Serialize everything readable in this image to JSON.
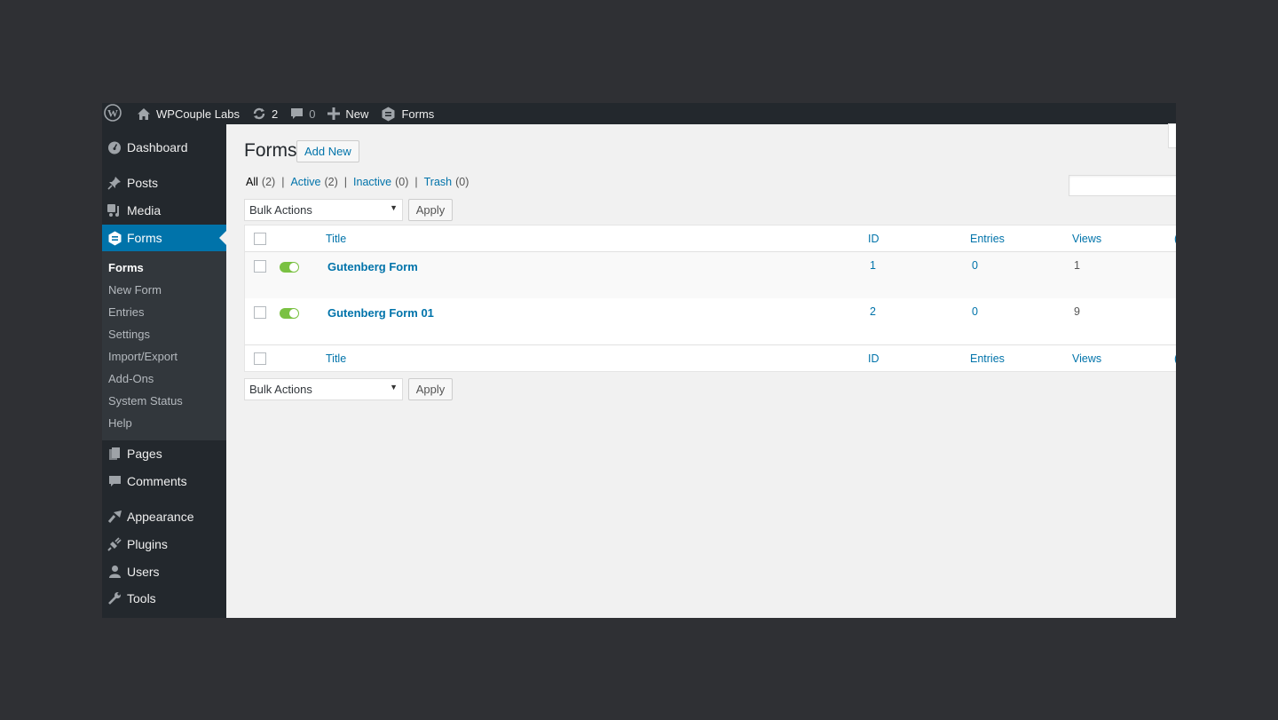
{
  "adminbar": {
    "site_name": "WPCouple Labs",
    "updates_count": "2",
    "comments_count": "0",
    "new_label": "New",
    "forms_label": "Forms"
  },
  "sidebar": {
    "items": [
      {
        "label": "Dashboard",
        "icon": "dashboard-icon"
      },
      {
        "label": "Posts",
        "icon": "pin-icon"
      },
      {
        "label": "Media",
        "icon": "media-icon"
      },
      {
        "label": "Forms",
        "icon": "forms-icon",
        "active": true
      },
      {
        "label": "Pages",
        "icon": "pages-icon"
      },
      {
        "label": "Comments",
        "icon": "comment-icon"
      },
      {
        "label": "Appearance",
        "icon": "brush-icon"
      },
      {
        "label": "Plugins",
        "icon": "plug-icon"
      },
      {
        "label": "Users",
        "icon": "user-icon"
      },
      {
        "label": "Tools",
        "icon": "wrench-icon"
      }
    ],
    "submenu": [
      "Forms",
      "New Form",
      "Entries",
      "Settings",
      "Import/Export",
      "Add-Ons",
      "System Status",
      "Help"
    ]
  },
  "page": {
    "title": "Forms",
    "add_new": "Add New",
    "filters": [
      {
        "label": "All",
        "count": "(2)",
        "current": true
      },
      {
        "label": "Active",
        "count": "(2)"
      },
      {
        "label": "Inactive",
        "count": "(0)"
      },
      {
        "label": "Trash",
        "count": "(0)"
      }
    ],
    "search_value": "",
    "bulk_actions": "Bulk Actions",
    "apply": "Apply"
  },
  "table": {
    "columns": [
      "Title",
      "ID",
      "Entries",
      "Views"
    ],
    "rows": [
      {
        "title": "Gutenberg Form",
        "id": "1",
        "entries": "0",
        "views": "1",
        "active": true
      },
      {
        "title": "Gutenberg Form 01",
        "id": "2",
        "entries": "0",
        "views": "9",
        "active": true
      }
    ]
  },
  "colors": {
    "accent": "#0073aa",
    "toggle_on": "#7ac142",
    "adminbar_bg": "#23282d",
    "submenu_bg": "#32373c"
  }
}
